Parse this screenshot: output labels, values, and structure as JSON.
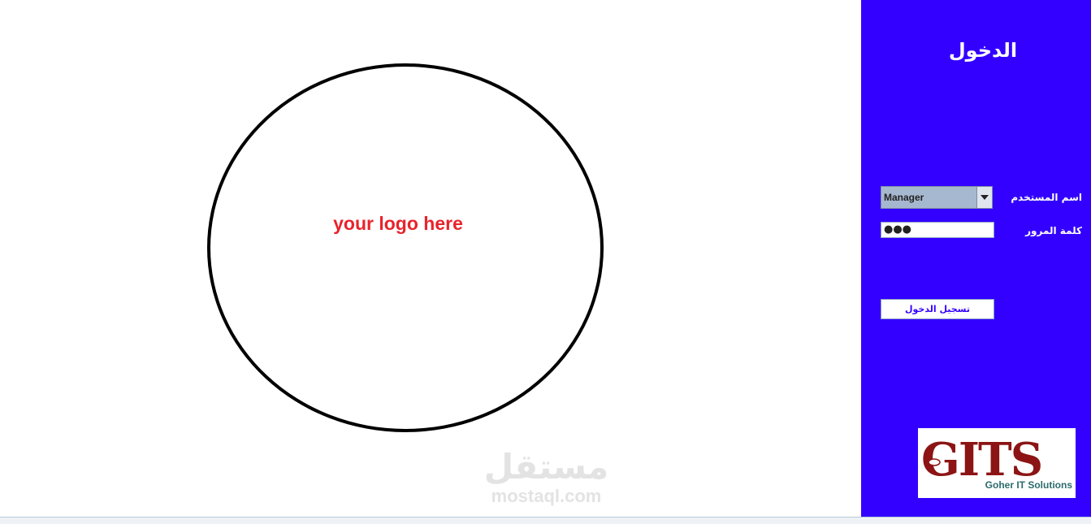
{
  "logo_area": {
    "placeholder_text": "your logo here",
    "text_color": "#e8232c"
  },
  "watermark": {
    "arabic": "مستقل",
    "english": "mostaql.com"
  },
  "login_panel": {
    "background": "#3300ff",
    "title": "الدخول",
    "username_label": "اسم المستخدم",
    "username_value": "Manager",
    "password_label": "كلمة المرور",
    "password_value": "●●●",
    "login_button": "تسجيل الدخول"
  },
  "brand": {
    "name": "GITS",
    "tagline": "Goher IT Solutions",
    "primary_color": "#8c1414",
    "tagline_color": "#2b6b6b"
  }
}
